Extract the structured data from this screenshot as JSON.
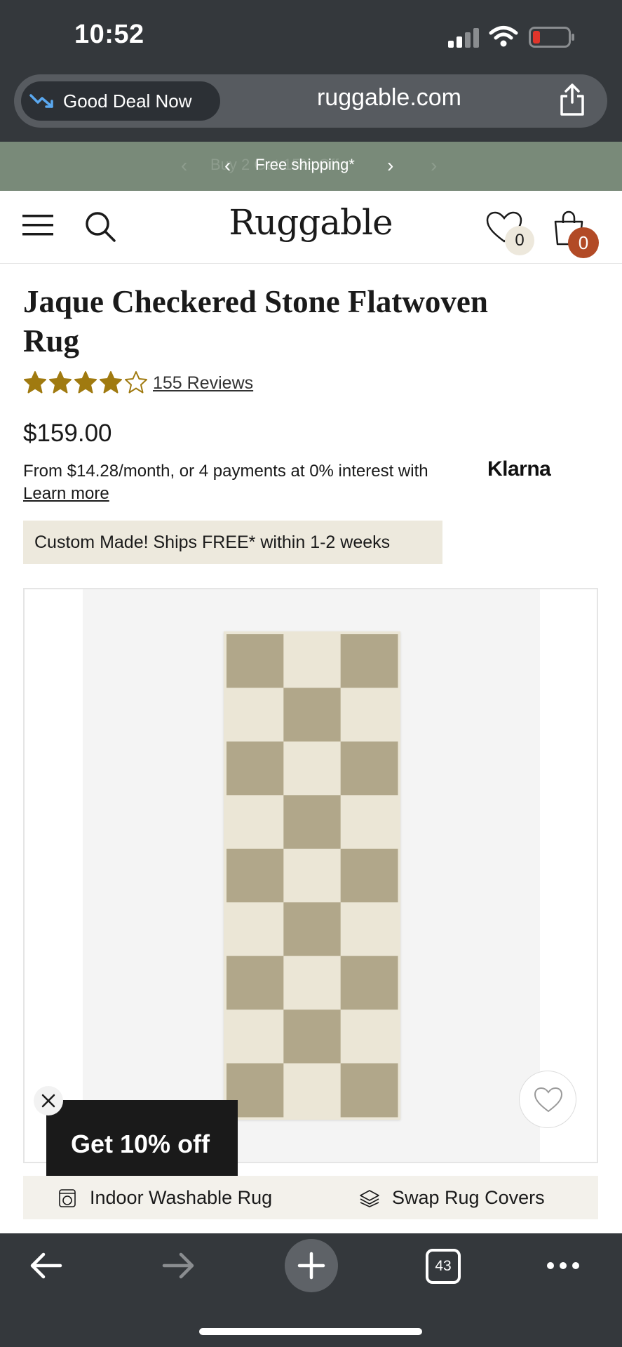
{
  "status_bar": {
    "time": "10:52",
    "icons": [
      "signal-icon",
      "wifi-icon",
      "battery-icon"
    ]
  },
  "browser": {
    "deal_label": "Good Deal Now",
    "url": "ruggable.com",
    "icons": [
      "trend-down-icon",
      "share-icon"
    ],
    "bottom_bar": {
      "tab_count": "43",
      "icons": [
        "back-icon",
        "forward-icon",
        "plus-icon",
        "tabs-icon",
        "more-icon"
      ]
    }
  },
  "promo": {
    "ghost_text": "Buy 2 Get 15% Off",
    "message": "Free shipping*"
  },
  "header": {
    "logo": "Ruggable",
    "wishlist_count": "0",
    "cart_count": "0",
    "icons": [
      "hamburger-icon",
      "search-icon",
      "heart-icon",
      "bag-icon"
    ]
  },
  "product": {
    "title": "Jaque Checkered Stone Flatwoven Rug",
    "rating": 4,
    "rating_max": 5,
    "reviews": "155 Reviews",
    "price": "$159.00",
    "financing": "From $14.28/month, or 4 payments at 0% interest with",
    "financing_brand": "Klarna",
    "learn_more": "Learn more",
    "shipping_note": "Custom Made! Ships FREE* within 1-2 weeks",
    "rug_colors": {
      "dark": "#b1a78a",
      "light": "#ebe6d6"
    }
  },
  "popup": {
    "offer": "Get 10% off"
  },
  "features": [
    {
      "label": "Indoor Washable Rug",
      "icon": "washer-icon"
    },
    {
      "label": "Swap Rug Covers",
      "icon": "swap-layers-icon"
    }
  ],
  "colors": {
    "chrome": "#34383c",
    "promo_green": "#798a79",
    "cart_badge": "#b24a26",
    "star_gold": "#a07a10"
  }
}
